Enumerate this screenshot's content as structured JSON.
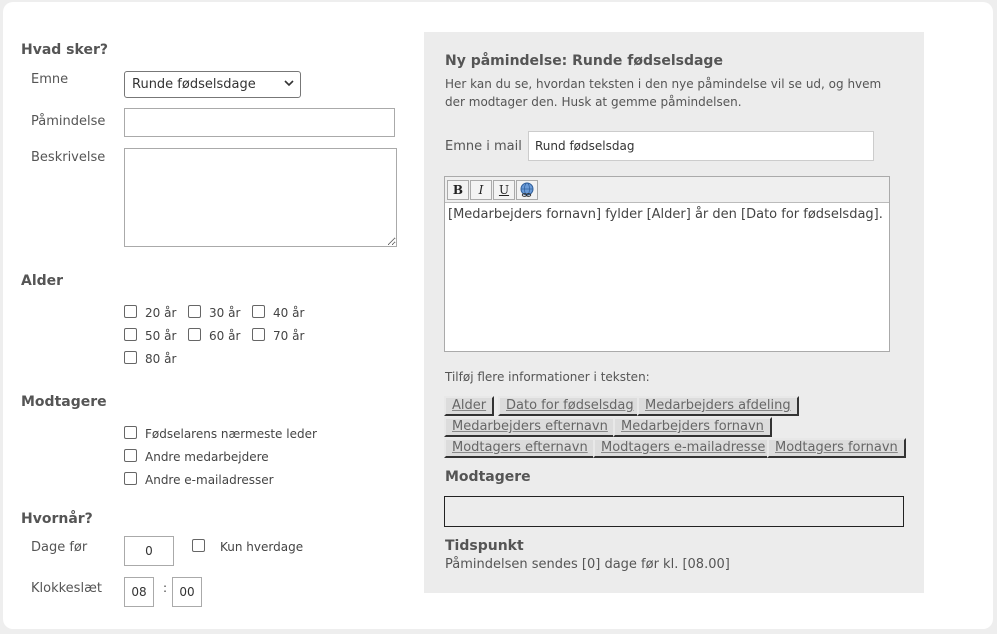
{
  "left": {
    "section_what": "Hvad sker?",
    "subject_label": "Emne",
    "subject_value": "Runde fødselsdage",
    "reminder_label": "Påmindelse",
    "reminder_value": "",
    "description_label": "Beskrivelse",
    "description_value": "",
    "section_age": "Alder",
    "ages": [
      {
        "label": "20 år",
        "checked": false
      },
      {
        "label": "30 år",
        "checked": false
      },
      {
        "label": "40 år",
        "checked": false
      },
      {
        "label": "50 år",
        "checked": false
      },
      {
        "label": "60 år",
        "checked": false
      },
      {
        "label": "70 år",
        "checked": false
      },
      {
        "label": "80 år",
        "checked": false
      }
    ],
    "section_recipients": "Modtagere",
    "recipients": [
      {
        "label": "Fødselarens nærmeste leder",
        "checked": false
      },
      {
        "label": "Andre medarbejdere",
        "checked": false
      },
      {
        "label": "Andre e-mailadresser",
        "checked": false
      }
    ],
    "section_when": "Hvornår?",
    "days_before_label": "Dage før",
    "days_before_value": "0",
    "weekdays_label": "Kun hverdage",
    "time_label": "Klokkeslæt",
    "hour_value": "08",
    "time_sep": ":",
    "minute_value": "00"
  },
  "preview": {
    "title": "Ny påmindelse: Runde fødselsdage",
    "intro": "Her kan du se, hvordan teksten i den nye påmindelse vil se ud, og hvem der modtager den. Husk at gemme påmindelsen.",
    "mail_subject_label": "Emne i mail",
    "mail_subject_value": "Rund fødselsdag",
    "toolbar": {
      "bold": "B",
      "italic": "I",
      "underline": "U",
      "link_icon": "link-globe-icon"
    },
    "body_text": "[Medarbejders fornavn] fylder [Alder] år den [Dato for fødselsdag].",
    "add_info_label": "Tilføj flere informationer i teksten:",
    "tags": [
      "Alder",
      "Dato for fødselsdag",
      "Medarbejders afdeling",
      "Medarbejders efternavn",
      "Medarbejders fornavn",
      "Modtagers efternavn",
      "Modtagers e-mailadresse",
      "Modtagers fornavn"
    ],
    "recipients_title": "Modtagere",
    "recipients_value": "",
    "time_title": "Tidspunkt",
    "time_text": "Påmindelsen sendes [0] dage før kl. [08.00]"
  }
}
